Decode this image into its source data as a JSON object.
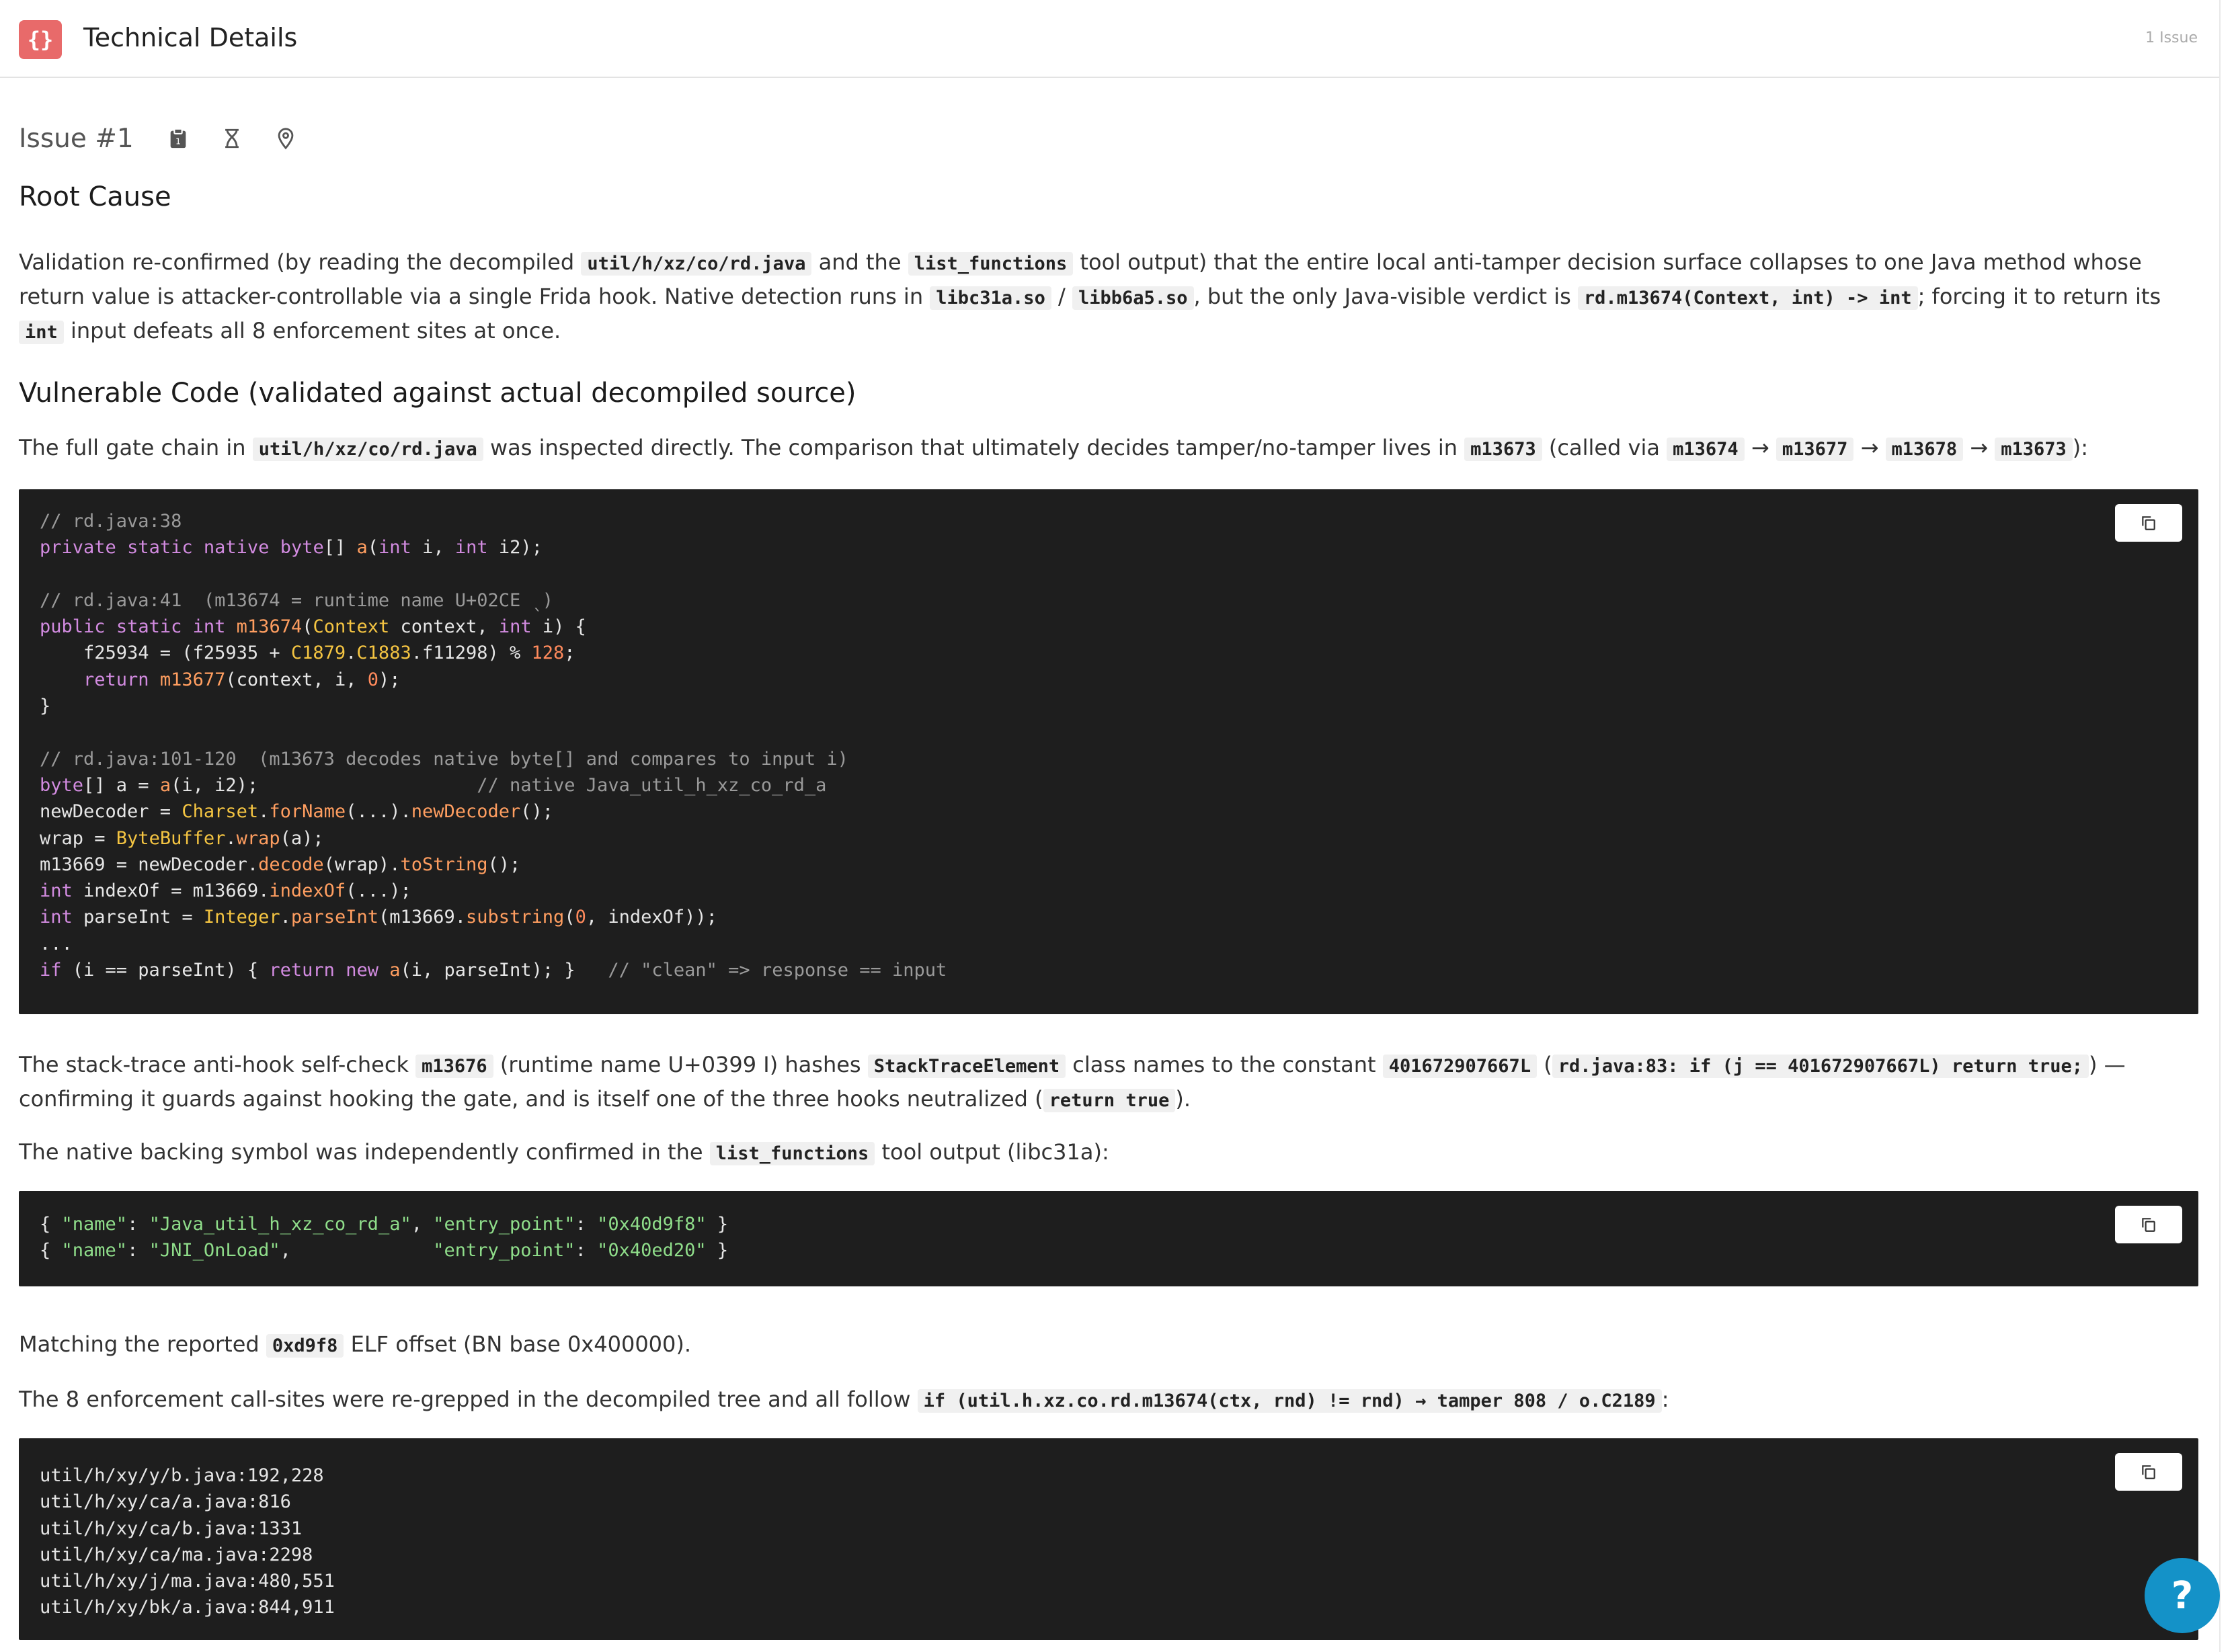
{
  "header": {
    "logo": "{}",
    "title": "Technical Details",
    "count": "1 Issue"
  },
  "issue": {
    "label": "Issue #1",
    "icons": [
      "clipboard-icon",
      "hourglass-icon",
      "location-pin-icon"
    ]
  },
  "sections": {
    "root_cause": {
      "heading": "Root Cause",
      "p1": [
        "Validation re-confirmed (by reading the decompiled ",
        "util/h/xz/co/rd.java",
        " and the ",
        "list_functions",
        " tool output) that the entire local anti-tamper decision surface collapses to one Java method whose return value is attacker-controllable via a single Frida hook. Native detection runs in ",
        "libc31a.so",
        " / ",
        "libb6a5.so",
        ", but the only Java-visible verdict is ",
        "rd.m13674(Context, int) -> int",
        "; forcing it to return its ",
        "int",
        " input defeats all 8 enforcement sites at once."
      ]
    },
    "vulnerable": {
      "heading": "Vulnerable Code (validated against actual decompiled source)",
      "p1": [
        "The full gate chain in ",
        "util/h/xz/co/rd.java",
        " was inspected directly. The comparison that ultimately decides tamper/no-tamper lives in ",
        "m13673",
        " (called via ",
        "m13674",
        " → ",
        "m13677",
        " → ",
        "m13678",
        " → ",
        "m13673",
        "):"
      ],
      "code_lines": [
        "// rd.java:38",
        "private static native byte[] a(int i, int i2);",
        "",
        "// rd.java:41  (m13674 = runtime name U+02CE ˎ)",
        "public static int m13674(Context context, int i) {",
        "    f25934 = (f25935 + C1879.C1883.f11298) % 128;",
        "    return m13677(context, i, 0);",
        "}",
        "",
        "// rd.java:101-120  (m13673 decodes native byte[] and compares to input i)",
        "byte[] a = a(i, i2);                    // native Java_util_h_xz_co_rd_a",
        "newDecoder = Charset.forName(...).newDecoder();",
        "wrap = ByteBuffer.wrap(a);",
        "m13669 = newDecoder.decode(wrap).toString();",
        "int indexOf = m13669.indexOf(...);",
        "int parseInt = Integer.parseInt(m13669.substring(0, indexOf));",
        "...",
        "if (i == parseInt) { return new a(i, parseInt); }   // \"clean\" => response == input"
      ],
      "p2": [
        "The stack-trace anti-hook self-check ",
        "m13676",
        " (runtime name U+0399 Ι) hashes ",
        "StackTraceElement",
        " class names to the constant ",
        "401672907667L",
        " (",
        "rd.java:83: if (j == 401672907667L) return true;",
        ") — confirming it guards against hooking the gate, and is itself one of the three hooks neutralized (",
        "return true",
        ")."
      ],
      "p3": [
        "The native backing symbol was independently confirmed in the ",
        "list_functions",
        " tool output (libc31a):"
      ],
      "json_lines": [
        "{ \"name\": \"Java_util_h_xz_co_rd_a\", \"entry_point\": \"0x40d9f8\" }",
        "{ \"name\": \"JNI_OnLoad\",             \"entry_point\": \"0x40ed20\" }"
      ],
      "p4": [
        "Matching the reported ",
        "0xd9f8",
        " ELF offset (BN base 0x400000)."
      ],
      "p5": [
        "The 8 enforcement call-sites were re-grepped in the decompiled tree and all follow ",
        "if (util.h.xz.co.rd.m13674(ctx, rnd) != rnd) → tamper 808 / o.C2189",
        ":"
      ],
      "sites_lines": [
        "util/h/xy/y/b.java:192,228",
        "util/h/xy/ca/a.java:816",
        "util/h/xy/ca/b.java:1331",
        "util/h/xy/ca/ma.java:2298",
        "util/h/xy/j/ma.java:480,551",
        "util/h/xy/bk/a.java:844,911"
      ]
    }
  },
  "help": {
    "label": "?"
  },
  "colors": {
    "logo": "#e86a6a",
    "code_bg": "#1e1e1e",
    "help": "#1492c8"
  }
}
